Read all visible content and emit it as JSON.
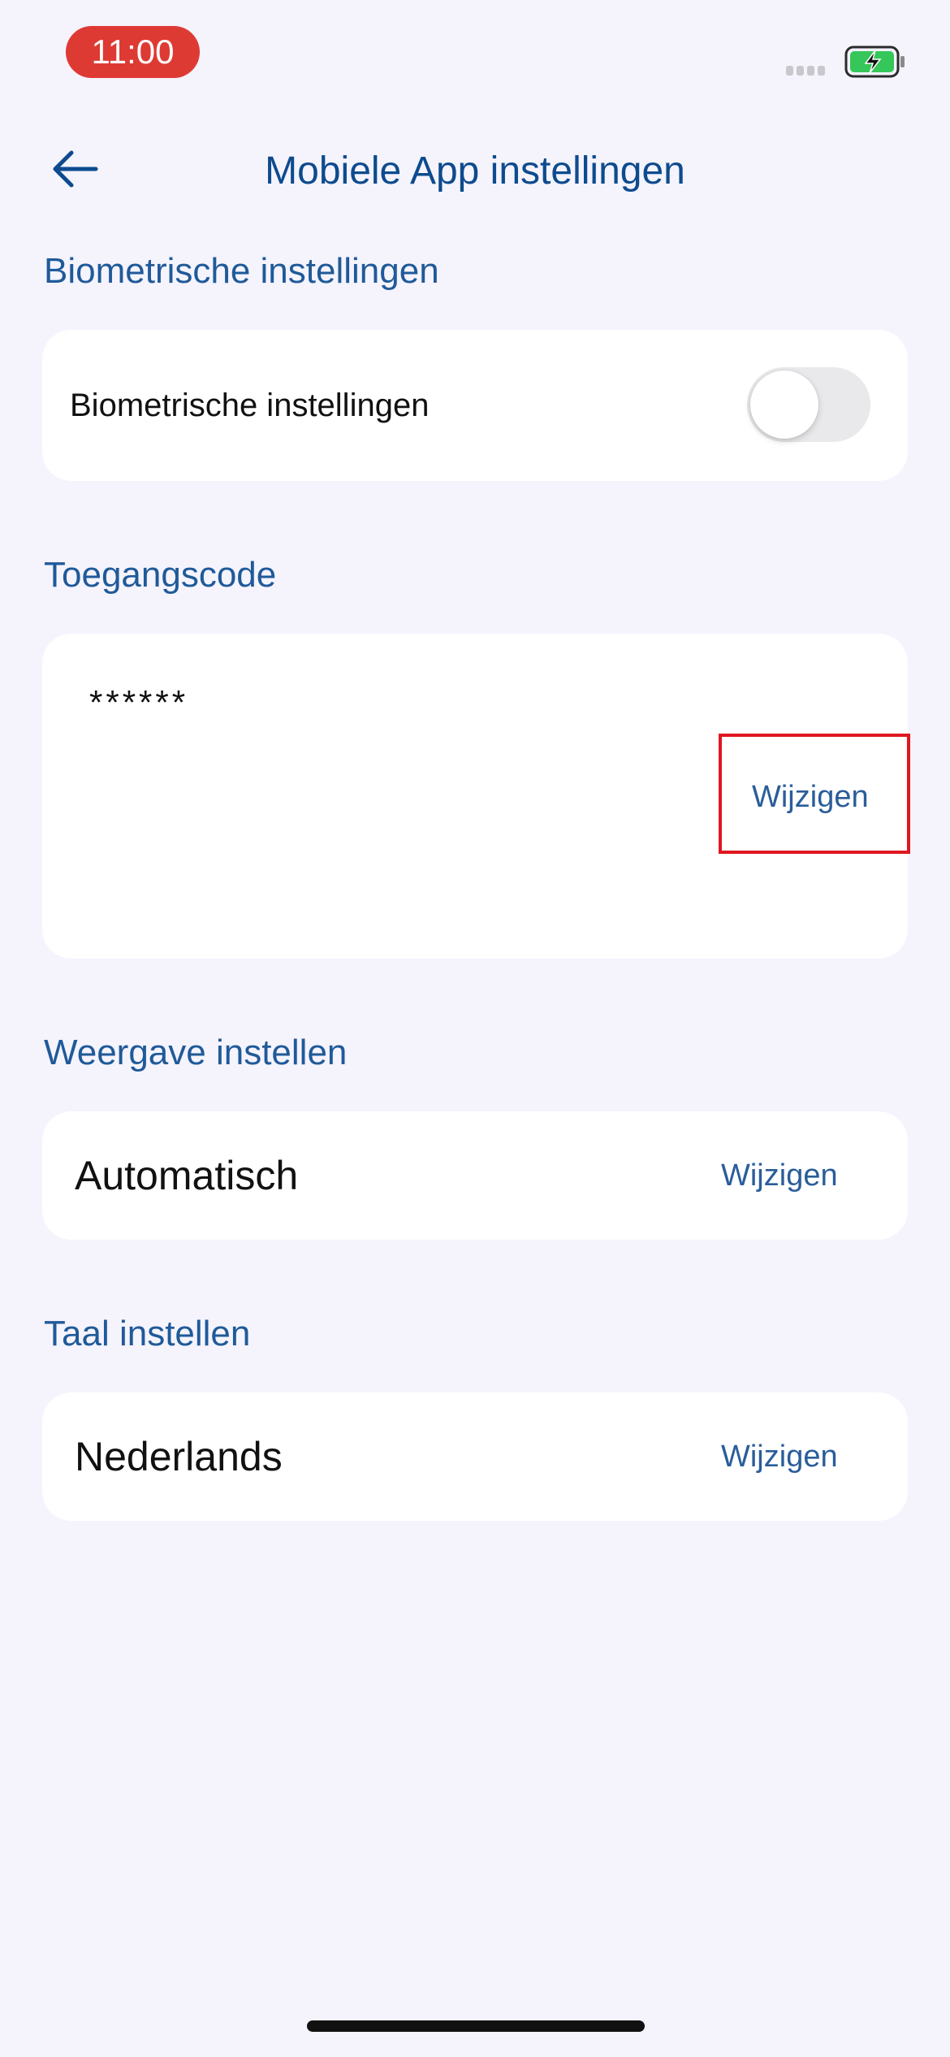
{
  "status_bar": {
    "time": "11:00",
    "battery_state": "charging",
    "colors": {
      "time_pill": "#de3a34",
      "battery_fill": "#35c759"
    }
  },
  "header": {
    "back_icon": "arrow-left-icon",
    "title": "Mobiele App instellingen"
  },
  "sections": {
    "biometric": {
      "title": "Biometrische instellingen",
      "row_label": "Biometrische instellingen",
      "toggle_on": false
    },
    "passcode": {
      "title": "Toegangscode",
      "value": "******",
      "action_label": "Wijzigen"
    },
    "display": {
      "title": "Weergave instellen",
      "value": "Automatisch",
      "action_label": "Wijzigen"
    },
    "language": {
      "title": "Taal instellen",
      "value": "Nederlands",
      "action_label": "Wijzigen"
    }
  },
  "colors": {
    "accent": "#0d4b8e",
    "background": "#f5f3fc",
    "card": "#ffffff",
    "highlight": "#e0171f"
  }
}
